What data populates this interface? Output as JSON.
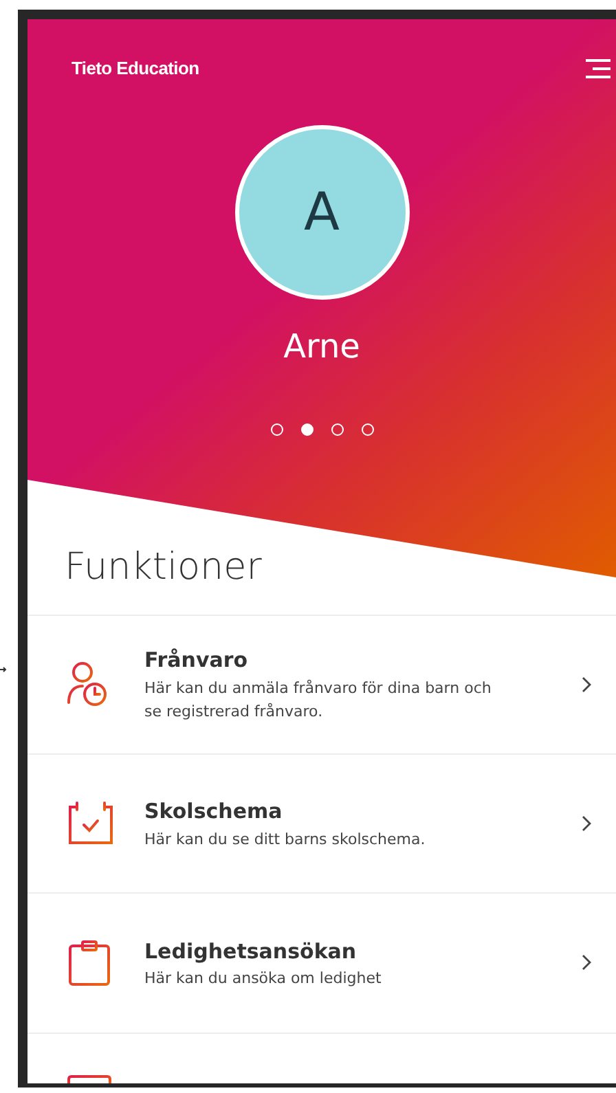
{
  "header": {
    "brand": "Tieto Education"
  },
  "profile": {
    "initial": "A",
    "name": "Arne"
  },
  "pager": [
    {
      "selected": false
    },
    {
      "selected": true
    },
    {
      "selected": false
    },
    {
      "selected": false
    }
  ],
  "section_title": "Funktioner",
  "items": [
    {
      "kind": "absence",
      "title": "Frånvaro",
      "description": "Här kan du anmäla frånvaro för dina barn och se registrerad frånvaro."
    },
    {
      "kind": "schedule",
      "title": "Skolschema",
      "description": "Här kan du se ditt barns skolschema."
    },
    {
      "kind": "leave",
      "title": "Ledighetsansökan",
      "description": "Här kan du ansöka om ledighet"
    },
    {
      "kind": "clipped"
    }
  ]
}
